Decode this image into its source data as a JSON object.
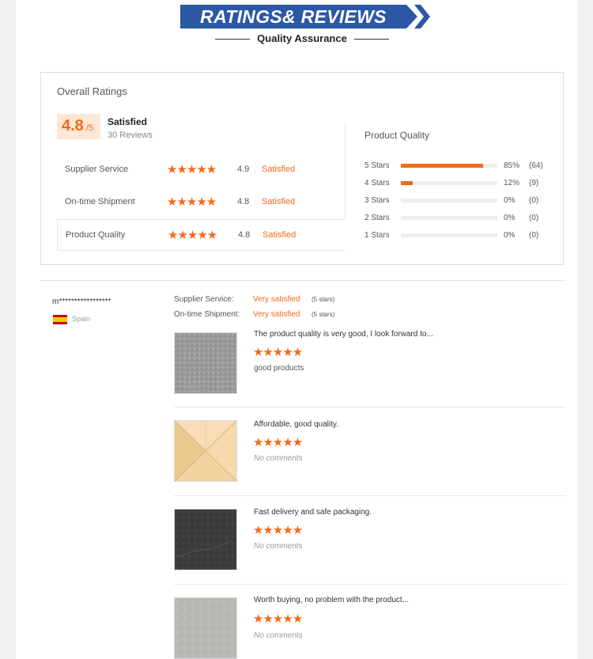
{
  "header": {
    "title": "RATINGS& REVIEWS",
    "subtitle": "Quality Assurance",
    "brand_color": "#2b57a5"
  },
  "overall": {
    "label": "Overall Ratings",
    "score": "4.8",
    "score_max": "/5",
    "status": "Satisfied",
    "reviews": "30 Reviews",
    "accent_color": "#f26a1b",
    "dimensions": [
      {
        "name": "Supplier Service",
        "stars": "★★★★★",
        "score": "4.9",
        "status": "Satisfied"
      },
      {
        "name": "On-time Shipment",
        "stars": "★★★★★",
        "score": "4.8",
        "status": "Satisfied"
      },
      {
        "name": "Product Quality",
        "stars": "★★★★★",
        "score": "4.8",
        "status": "Satisfied"
      }
    ]
  },
  "product_quality": {
    "title": "Product Quality",
    "bars": [
      {
        "label": "5 Stars",
        "fill": 0.85,
        "percent": "85%",
        "count": "(64)"
      },
      {
        "label": "4 Stars",
        "fill": 0.12,
        "percent": "12%",
        "count": "(9)"
      },
      {
        "label": "3 Stars",
        "fill": 0,
        "percent": "0%",
        "count": "(0)"
      },
      {
        "label": "2 Stars",
        "fill": 0,
        "percent": "0%",
        "count": "(0)"
      },
      {
        "label": "1 Stars",
        "fill": 0,
        "percent": "0%",
        "count": "(0)"
      }
    ]
  },
  "reviewer": {
    "name": "m*****************",
    "country": "Spain",
    "supplier_service_label": "Supplier Service:",
    "supplier_service_value": "Very satisfied",
    "supplier_service_stars": "(5 stars)",
    "shipment_label": "On-time Shipment:",
    "shipment_value": "Very satisfied",
    "shipment_stars": "(5 stars)"
  },
  "reviews": [
    {
      "text": "The product quality is very good, I look forward to...",
      "stars": "★★★★★",
      "comment": "good products",
      "thumb": "grey-stone"
    },
    {
      "text": "Affordable, good quality.",
      "stars": "★★★★★",
      "comment": "No comments",
      "thumb": "wood-parquet"
    },
    {
      "text": "Fast delivery and safe packaging.",
      "stars": "★★★★★",
      "comment": "No comments",
      "thumb": "dark-stone"
    },
    {
      "text": "Worth buying, no problem with the product...",
      "stars": "★★★★★",
      "comment": "No comments",
      "thumb": "light-stone"
    }
  ]
}
